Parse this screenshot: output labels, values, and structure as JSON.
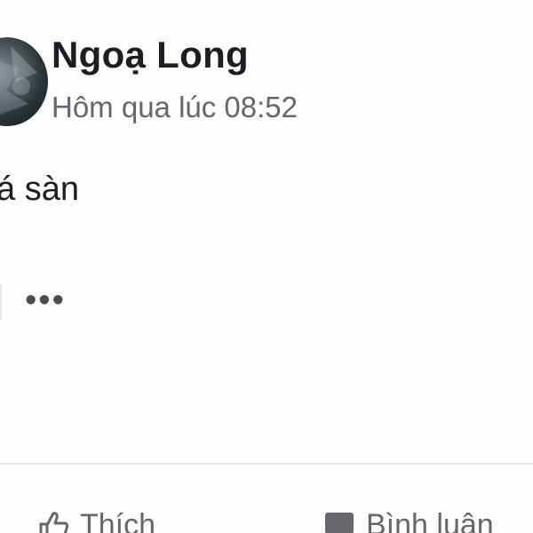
{
  "post": {
    "author_name": "Ngoạ Long",
    "timestamp": "Hôm qua lúc 08:52",
    "text": "á sàn",
    "more_label": "•••"
  },
  "actions": {
    "like_label": "Thích",
    "comment_label": "Bình luận"
  },
  "icons": {
    "avatar": "profile-photo",
    "like": "thumbs-up-icon",
    "comment": "comment-icon"
  },
  "colors": {
    "name_text": "#1c1e21",
    "secondary_text": "#65676b",
    "divider": "#e9eaec"
  }
}
